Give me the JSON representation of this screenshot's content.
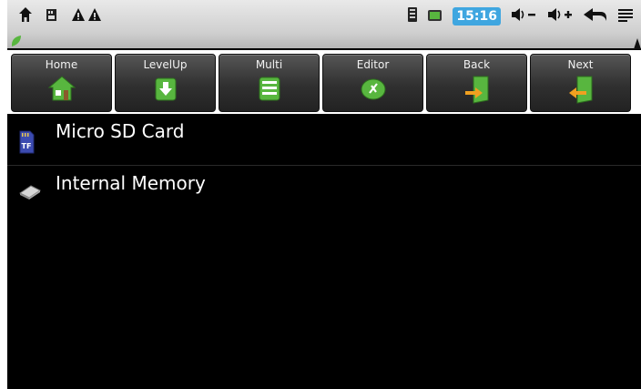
{
  "status_bar": {
    "time": "15:16"
  },
  "toolbar": {
    "buttons": [
      {
        "label": "Home"
      },
      {
        "label": "LevelUp"
      },
      {
        "label": "Multi"
      },
      {
        "label": "Editor"
      },
      {
        "label": "Back"
      },
      {
        "label": "Next"
      }
    ]
  },
  "storage_list": {
    "items": [
      {
        "label": "Micro SD Card",
        "icon": "sd-card-icon"
      },
      {
        "label": "Internal Memory",
        "icon": "internal-memory-icon"
      }
    ]
  },
  "colors": {
    "accent_green": "#58b63f",
    "clock_bg": "#3fa6e0"
  }
}
